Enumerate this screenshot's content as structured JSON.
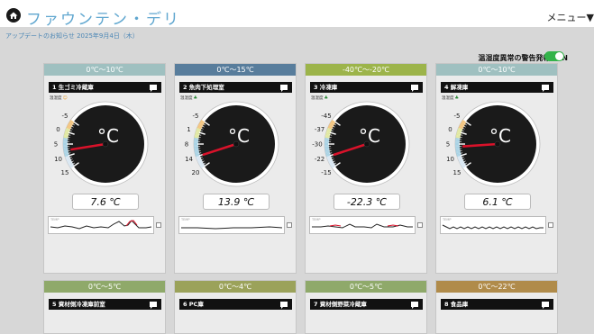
{
  "header": {
    "title": "ファウンテン・デリ",
    "menu_label": "メニュー▼"
  },
  "update_notice": "アップデートのお知らせ  2025年9月4日（木）",
  "alarm": {
    "label": "温湿度異常の警告発報: ON",
    "enabled": true
  },
  "cards": [
    {
      "range": "0℃〜10℃",
      "name": "1 生ゴミ冷蔵庫",
      "temp_label": "温湿度",
      "status_mark": "☺",
      "status_color": "#e7a23a",
      "range_color": "#9fc0c0",
      "scale_max": 15,
      "scale_min": -5,
      "ticks": [
        "15",
        "10",
        "5",
        "0",
        "-5"
      ],
      "value": 7.6,
      "reading": "7.6 ℃",
      "spark_label": "TEMP"
    },
    {
      "range": "0℃〜15℃",
      "name": "2 魚肉下処理室",
      "temp_label": "温湿度",
      "status_mark": "♣",
      "status_color": "#2e8b3a",
      "range_color": "#587d9c",
      "scale_max": 20,
      "scale_min": -5,
      "ticks": [
        "20",
        "14",
        "8",
        "1",
        "-5"
      ],
      "value": 13.9,
      "reading": "13.9 ℃",
      "spark_label": "TEMP"
    },
    {
      "range": "-40℃〜-20℃",
      "name": "3 冷凍庫",
      "temp_label": "温湿度",
      "status_mark": "♣",
      "status_color": "#2e8b3a",
      "range_color": "#9cb44a",
      "scale_max": -15,
      "scale_min": -45,
      "ticks": [
        "-15",
        "-22",
        "-30",
        "-37",
        "-45"
      ],
      "value": -22.3,
      "reading": "-22.3 ℃",
      "spark_label": "TEMP"
    },
    {
      "range": "0℃〜10℃",
      "name": "4 解凍庫",
      "temp_label": "温湿度",
      "status_mark": "♣",
      "status_color": "#2e8b3a",
      "range_color": "#9fc0c0",
      "scale_max": 15,
      "scale_min": -5,
      "ticks": [
        "15",
        "10",
        "5",
        "0",
        "-5"
      ],
      "value": 6.1,
      "reading": "6.1 ℃",
      "spark_label": "TEMP"
    }
  ],
  "cards_row2": [
    {
      "range": "0℃〜5℃",
      "name": "5 資材側冷凍庫前室",
      "range_color": "#8fa96a"
    },
    {
      "range": "0℃〜4℃",
      "name": "6 PC庫",
      "range_color": "#9ba25a"
    },
    {
      "range": "0℃〜5℃",
      "name": "7 資材側野菜冷蔵庫",
      "range_color": "#8fa96a"
    },
    {
      "range": "0℃〜22℃",
      "name": "8 食品庫",
      "range_color": "#b08b4a"
    }
  ],
  "colors": {
    "needle": "#d9122a",
    "dial": "#1a1a1a",
    "accent": "#5fa6cf",
    "toggle_on": "#34b34a"
  }
}
